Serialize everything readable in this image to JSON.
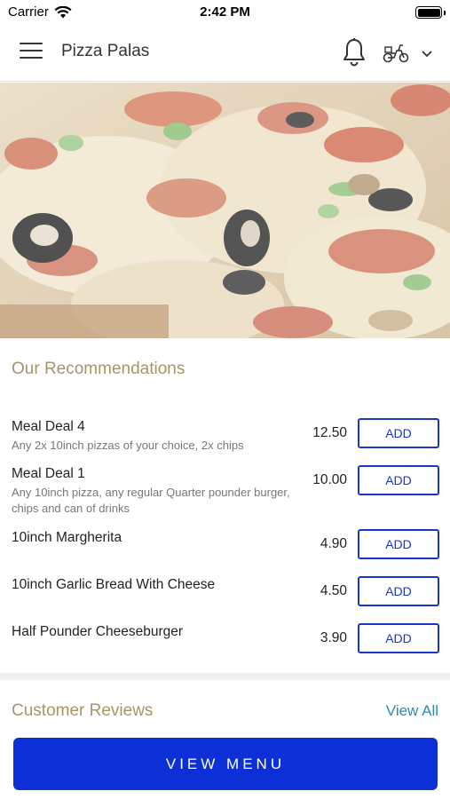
{
  "status_bar": {
    "carrier": "Carrier",
    "time": "2:42 PM"
  },
  "header": {
    "title": "Pizza Palas",
    "menu_icon": "hamburger-menu-icon",
    "notification_icon": "bell-icon",
    "delivery_icon": "scooter-icon",
    "dropdown_icon": "chevron-down-icon"
  },
  "hero": {
    "image": "pizza-photo"
  },
  "recommendations": {
    "title": "Our Recommendations",
    "items": [
      {
        "name": "Meal Deal 4",
        "description": "Any 2x 10inch pizzas of your choice, 2x chips",
        "price": "12.50",
        "button": "ADD"
      },
      {
        "name": "Meal Deal 1",
        "description": "Any 10inch  pizza, any regular Quarter pounder burger, chips and can of drinks",
        "price": "10.00",
        "button": "ADD"
      },
      {
        "name": "10inch Margherita",
        "description": "",
        "price": "4.90",
        "button": "ADD"
      },
      {
        "name": "10inch Garlic Bread With Cheese",
        "description": "",
        "price": "4.50",
        "button": "ADD"
      },
      {
        "name": "Half Pounder Cheeseburger",
        "description": "",
        "price": "3.90",
        "button": "ADD"
      }
    ]
  },
  "reviews": {
    "title": "Customer Reviews",
    "view_all": "View All"
  },
  "footer": {
    "view_menu": "VIEW MENU"
  },
  "colors": {
    "accent_blue": "#0d2fd6",
    "add_border": "#1a35c9",
    "section_title": "#a8946a",
    "link": "#2c8ab5"
  }
}
